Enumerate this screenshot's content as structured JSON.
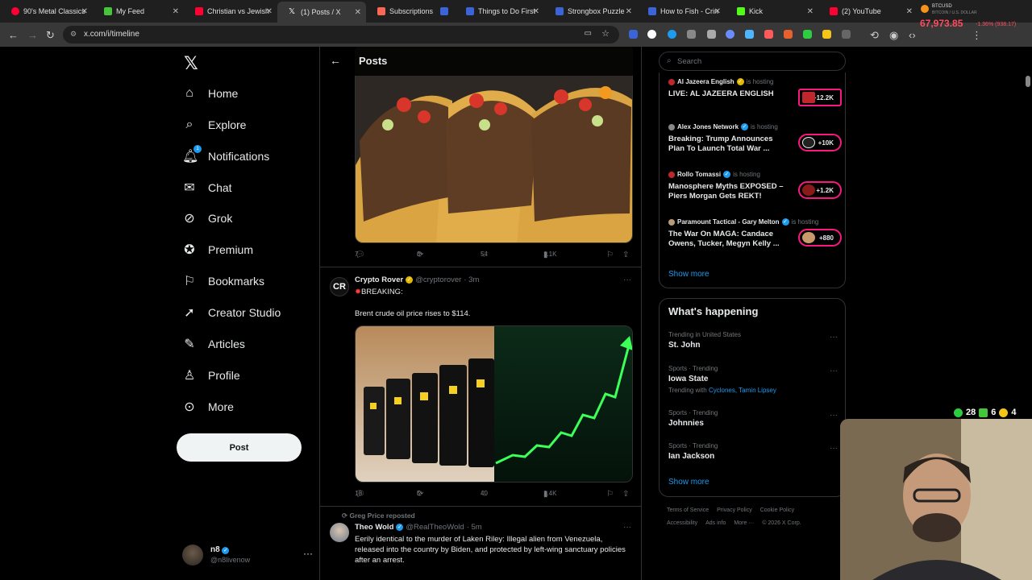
{
  "browser": {
    "tabs": [
      {
        "label": "90's Metal Classics",
        "color": "#ff0033"
      },
      {
        "label": "My Feed",
        "color": "#45c53a"
      },
      {
        "label": "Christian vs Jewish",
        "color": "#ff0033"
      },
      {
        "label": "(1) Posts / X",
        "color": "#ffffff",
        "active": true
      },
      {
        "label": "Subscriptions",
        "color": "#f96854"
      },
      {
        "label": "Things to Do First",
        "color": "#3a64d8"
      },
      {
        "label": "Strongbox Puzzle",
        "color": "#3a64d8"
      },
      {
        "label": "How to Fish - Crin",
        "color": "#3a64d8"
      },
      {
        "label": "Kick",
        "color": "#53fc18"
      },
      {
        "label": "(2) YouTube",
        "color": "#ff0033"
      }
    ],
    "url": "x.com/i/timeline",
    "ticker": {
      "symbol": "BTCUSD",
      "name": "BITCOIN / U.S. DOLLAR",
      "price": "67,973.85",
      "change": "-1.36% (938.17)"
    }
  },
  "sidebar": {
    "logo": "𝕏",
    "items": [
      {
        "label": "Home",
        "icon": "home-icon"
      },
      {
        "label": "Explore",
        "icon": "search-icon"
      },
      {
        "label": "Notifications",
        "icon": "bell-icon",
        "badge": "1"
      },
      {
        "label": "Chat",
        "icon": "mail-icon"
      },
      {
        "label": "Grok",
        "icon": "grok-icon"
      },
      {
        "label": "Premium",
        "icon": "verified-icon"
      },
      {
        "label": "Bookmarks",
        "icon": "bookmark-icon"
      },
      {
        "label": "Creator Studio",
        "icon": "rocket-icon"
      },
      {
        "label": "Articles",
        "icon": "article-icon"
      },
      {
        "label": "Profile",
        "icon": "person-icon"
      },
      {
        "label": "More",
        "icon": "more-icon"
      }
    ],
    "post_button": "Post",
    "account": {
      "name": "n8",
      "handle": "@n8livenow"
    }
  },
  "main": {
    "title": "Posts",
    "post1": {
      "replies": "7",
      "reposts": "3",
      "likes": "54",
      "views": "1.1K"
    },
    "post2": {
      "name": "Crypto Rover",
      "handle": "@cryptorover",
      "time": "· 3m",
      "line1": "BREAKING:",
      "line2": "Brent crude oil price rises to $114.",
      "replies": "18",
      "reposts": "5",
      "likes": "40",
      "views": "1.4K"
    },
    "post3": {
      "repost_note": "Greg Price reposted",
      "name": "Theo Wold",
      "handle": "@RealTheoWold",
      "time": "· 5m",
      "text": "Eerily identical to the murder of Laken Riley: Illegal alien from Venezuela, released into the country by Biden, and protected by left-wing sanctuary policies after an arrest."
    }
  },
  "right": {
    "search_placeholder": "Search",
    "live": [
      {
        "who": "Al Jazeera English",
        "status": "is hosting",
        "title": "LIVE: AL JAZEERA ENGLISH",
        "count": "+12.2K"
      },
      {
        "who": "Alex Jones Network",
        "status": "is hosting",
        "title": "Breaking: Trump Announces Plan To Launch Total War ...",
        "count": "+10K"
      },
      {
        "who": "Rollo Tomassi",
        "status": "is hosting",
        "title": "Manosphere Myths EXPOSED – Piers Morgan Gets REKT!",
        "count": "+1.2K"
      },
      {
        "who": "Paramount Tactical - Gary Melton",
        "status": "is hosting",
        "title": "The War On MAGA: Candace Owens, Tucker, Megyn Kelly ...",
        "count": "+880"
      }
    ],
    "show_more": "Show more",
    "whats_happening": "What's happening",
    "trends": [
      {
        "context": "Trending in United States",
        "name": "St. John"
      },
      {
        "context": "Sports · Trending",
        "name": "Iowa State",
        "with_label": "Trending with",
        "with": "Cyclones, Tamin Lipsey"
      },
      {
        "context": "Sports · Trending",
        "name": "Johnnies"
      },
      {
        "context": "Sports · Trending",
        "name": "Ian Jackson"
      }
    ],
    "show_more2": "Show more",
    "footer": [
      "Terms of Service",
      "Privacy Policy",
      "Cookie Policy",
      "Accessibility",
      "Ads info",
      "More ···",
      "© 2026 X Corp."
    ]
  },
  "overlay": {
    "stat1": "28",
    "stat2": "6",
    "stat3": "4"
  }
}
